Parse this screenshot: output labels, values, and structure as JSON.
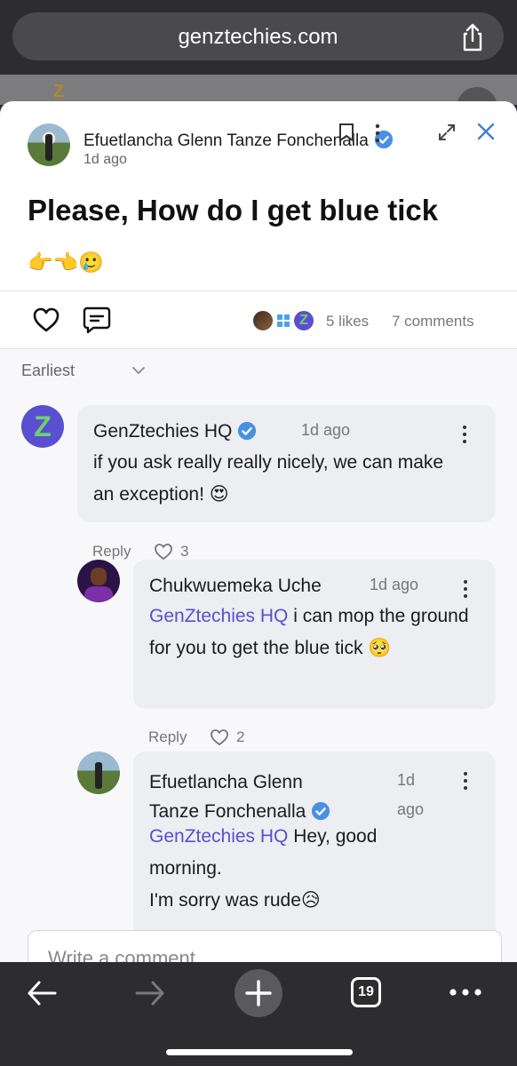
{
  "browser": {
    "url": "genztechies.com",
    "tab_count": "19"
  },
  "post": {
    "author": "Efuetlancha Glenn Tanze Fonchenalla",
    "time": "1d ago",
    "title": "Please, How do I get blue tick",
    "emoji": "👉👈🥲",
    "likes": "5 likes",
    "comments": "7 comments"
  },
  "comments_section": {
    "sort_label": "Earliest",
    "composer_placeholder": "Write a comment"
  },
  "comments": [
    {
      "author": "GenZtechies HQ",
      "verified": true,
      "time": "1d ago",
      "text": "if you ask really really nicely, we can make an exception! 😍",
      "reply_label": "Reply",
      "likes": "3"
    },
    {
      "author": "Chukwuemeka Uche",
      "verified": false,
      "time": "1d ago",
      "mention": "GenZtechies HQ",
      "text": " i can mop the ground for you to get the blue tick 🥺",
      "reply_label": "Reply",
      "likes": "2"
    },
    {
      "author_line1": "Efuetlancha Glenn",
      "author_line2": "Tanze Fonchenalla",
      "verified": true,
      "time_line1": "1d",
      "time_line2": "ago",
      "mention": "GenZtechies HQ",
      "text_line1": " Hey, good",
      "text_line2": "morning.",
      "text_line3": "I'm sorry was rude😥"
    }
  ],
  "colors": {
    "accent": "#5a4fcf",
    "verified": "#4a90e2",
    "chrome": "#2d2d2f"
  }
}
